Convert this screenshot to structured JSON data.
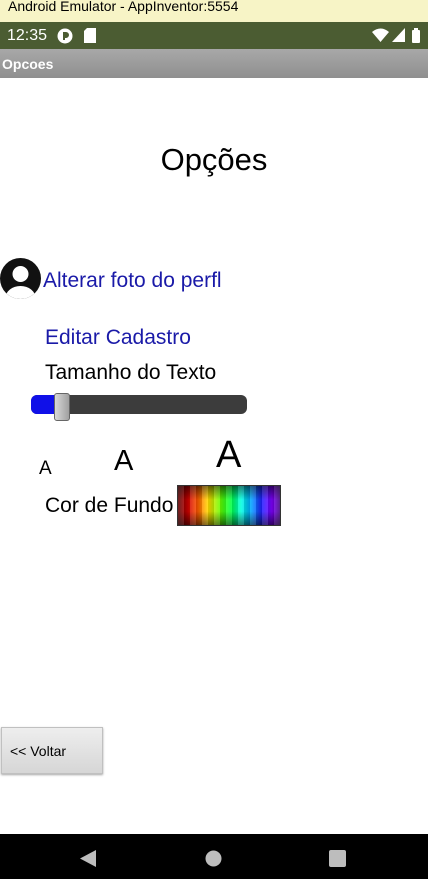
{
  "window": {
    "title": "Android Emulator - AppInventor:5554"
  },
  "status_bar": {
    "time": "12:35",
    "icons": [
      "app-notification-icon",
      "sd-card-icon",
      "wifi-icon",
      "signal-icon",
      "battery-icon"
    ]
  },
  "action_bar": {
    "title": "Opcoes"
  },
  "screen": {
    "title": "Opções",
    "change_photo_label": "Alterar foto do perfl",
    "edit_profile_label": "Editar Cadastro",
    "text_size_label": "Tamanho do Texto",
    "text_size_slider": {
      "value_fraction": 0.14,
      "fill_color": "#1010e8",
      "track_color": "#3c3c3c"
    },
    "size_samples": [
      "A",
      "A",
      "A"
    ],
    "background_color_label": "Cor de Fundo",
    "back_button_label": "<<  Voltar"
  },
  "colors": {
    "status_bar": "#4b5c32",
    "action_bar": "#999999",
    "link_text": "#1a1aa8",
    "nav_bar": "#000000"
  },
  "nav_bar": {
    "buttons": [
      "back-icon",
      "home-icon",
      "recents-icon"
    ]
  }
}
